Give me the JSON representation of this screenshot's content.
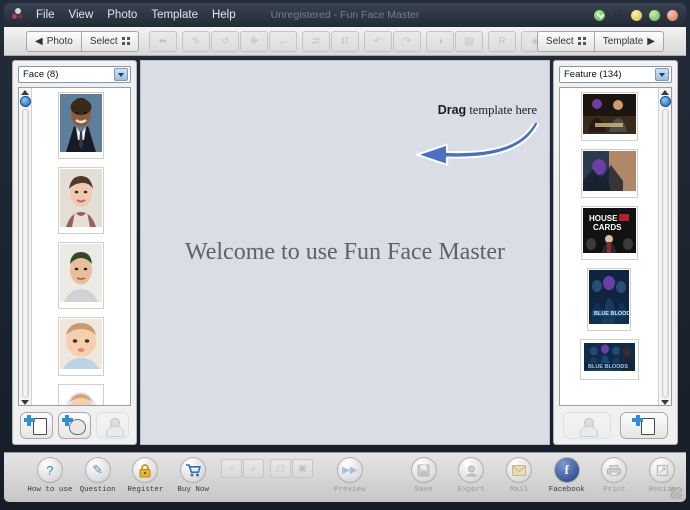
{
  "window": {
    "title": "Unregistered - Fun Face Master",
    "logo_icon": "app-logo-icon",
    "controls": [
      {
        "name": "download-icon",
        "color": "#3faa34"
      },
      {
        "name": "gear-icon",
        "glyph": "⚙",
        "color": "#2b3038"
      },
      {
        "name": "minimize-button",
        "color": "#d9b93f"
      },
      {
        "name": "maximize-button",
        "color": "#63b052"
      },
      {
        "name": "close-button",
        "color": "#d8705c"
      }
    ]
  },
  "menubar": {
    "items": [
      {
        "label": "File"
      },
      {
        "label": "View"
      },
      {
        "label": "Photo"
      },
      {
        "label": "Template"
      },
      {
        "label": "Help"
      }
    ]
  },
  "toolbar": {
    "left_group": [
      {
        "label": "Photo",
        "icon": "caret-left-icon"
      },
      {
        "label": "Select",
        "icon": "grid-icon"
      }
    ],
    "right_group": [
      {
        "label": "Select",
        "icon": "grid-icon"
      },
      {
        "label": "Template",
        "icon": "caret-right-icon"
      }
    ],
    "disabled_buttons": [
      {
        "name": "align-tool",
        "glyph": "⬌"
      },
      {
        "name": "pencil-tool",
        "glyph": "✎"
      },
      {
        "name": "replace-tool",
        "glyph": "↺"
      },
      {
        "name": "move-tool",
        "glyph": "✥"
      },
      {
        "name": "resize-tool",
        "glyph": "↔"
      },
      {
        "name": "flip-horizontal-tool",
        "glyph": "⮂"
      },
      {
        "name": "flip-vertical-tool",
        "glyph": "⮃"
      },
      {
        "name": "rotate-left-tool",
        "glyph": "↶"
      },
      {
        "name": "rotate-right-tool",
        "glyph": "↷"
      },
      {
        "name": "brightness-tool",
        "glyph": "◑"
      },
      {
        "name": "contrast-tool",
        "glyph": "▧"
      },
      {
        "name": "blend-tool",
        "glyph": "R"
      },
      {
        "name": "color-tool",
        "glyph": "◈"
      }
    ]
  },
  "left_panel": {
    "name": "face-panel",
    "dropdown": {
      "value": "Face (8)",
      "options": [
        "Face (8)"
      ]
    },
    "scroll": {
      "up": "scroll-up-arrow",
      "down": "scroll-down-arrow"
    },
    "thumbnails": [
      {
        "name": "face-thumbnail-1",
        "alt": "man in dark suit with tie"
      },
      {
        "name": "face-thumbnail-2",
        "alt": "woman with short dark hair"
      },
      {
        "name": "face-thumbnail-3",
        "alt": "young man with short hair"
      },
      {
        "name": "face-thumbnail-4",
        "alt": "baby in blue collar"
      },
      {
        "name": "face-thumbnail-5",
        "alt": "baby with white hood"
      }
    ],
    "buttons": [
      {
        "name": "add-photo-button",
        "enabled": true
      },
      {
        "name": "add-face-button",
        "enabled": true
      },
      {
        "name": "delete-face-button",
        "enabled": false
      }
    ]
  },
  "right_panel": {
    "name": "template-panel",
    "dropdown": {
      "value": "Feature (134)",
      "options": [
        "Feature (134)"
      ]
    },
    "scroll": {
      "up": "scroll-up-arrow",
      "down": "scroll-down-arrow"
    },
    "thumbnails": [
      {
        "name": "template-thumbnail-1",
        "alt": "two men action movie poster"
      },
      {
        "name": "template-thumbnail-2",
        "alt": "sci-fi landscape poster"
      },
      {
        "name": "template-thumbnail-3",
        "alt": "House of Cards poster"
      },
      {
        "name": "template-thumbnail-4",
        "alt": "blue group portrait poster"
      },
      {
        "name": "template-thumbnail-5",
        "alt": "blue wide group poster"
      }
    ],
    "buttons": [
      {
        "name": "delete-template-button",
        "enabled": false
      },
      {
        "name": "add-template-button",
        "enabled": true
      }
    ]
  },
  "canvas": {
    "welcome_text": "Welcome to use Fun Face Master",
    "hint_bold": "Drag",
    "hint_rest": "template here",
    "arrow_icon": "curved-arrow-left-icon",
    "background_color": "#d9dde5"
  },
  "bottombar": {
    "buttons": [
      {
        "name": "how-to-use-button",
        "label": "How to use",
        "glyph": "?",
        "color": "#2e86c1",
        "enabled": true
      },
      {
        "name": "question-button",
        "label": "Question",
        "glyph": "✎",
        "color": "#5a8fbd",
        "enabled": true
      },
      {
        "name": "register-button",
        "label": "Register",
        "glyph": "🔒",
        "color": "#d9a117",
        "enabled": true
      },
      {
        "name": "buy-now-button",
        "label": "Buy Now",
        "glyph": "🛒",
        "color": "#2e6fb5",
        "enabled": true
      },
      {
        "name": "preview-button",
        "label": "Preview",
        "glyph": "▶▶",
        "color": "#9fb8d6",
        "enabled": false
      },
      {
        "name": "save-button",
        "label": "Save",
        "glyph": "💾",
        "color": "#b5b5b5",
        "enabled": false
      },
      {
        "name": "export-button",
        "label": "Export",
        "glyph": "⊙",
        "color": "#b5b5b5",
        "enabled": false
      },
      {
        "name": "mail-button",
        "label": "Mail",
        "glyph": "✉",
        "color": "#d2c089",
        "enabled": false
      },
      {
        "name": "facebook-button",
        "label": "Facebook",
        "glyph": "f",
        "color": "#3b5998",
        "enabled": true
      },
      {
        "name": "print-button",
        "label": "Print",
        "glyph": "☁",
        "color": "#b5b5b5",
        "enabled": false
      },
      {
        "name": "resize-button",
        "label": "Resize",
        "glyph": "⛶",
        "color": "#b5b5b5",
        "enabled": false
      }
    ],
    "small_buttons": [
      {
        "name": "zoom-in-button",
        "glyph": "⌕"
      },
      {
        "name": "zoom-out-button",
        "glyph": "⌕"
      },
      {
        "name": "fit-window-button",
        "glyph": "▢"
      },
      {
        "name": "actual-size-button",
        "glyph": "▣"
      }
    ]
  }
}
